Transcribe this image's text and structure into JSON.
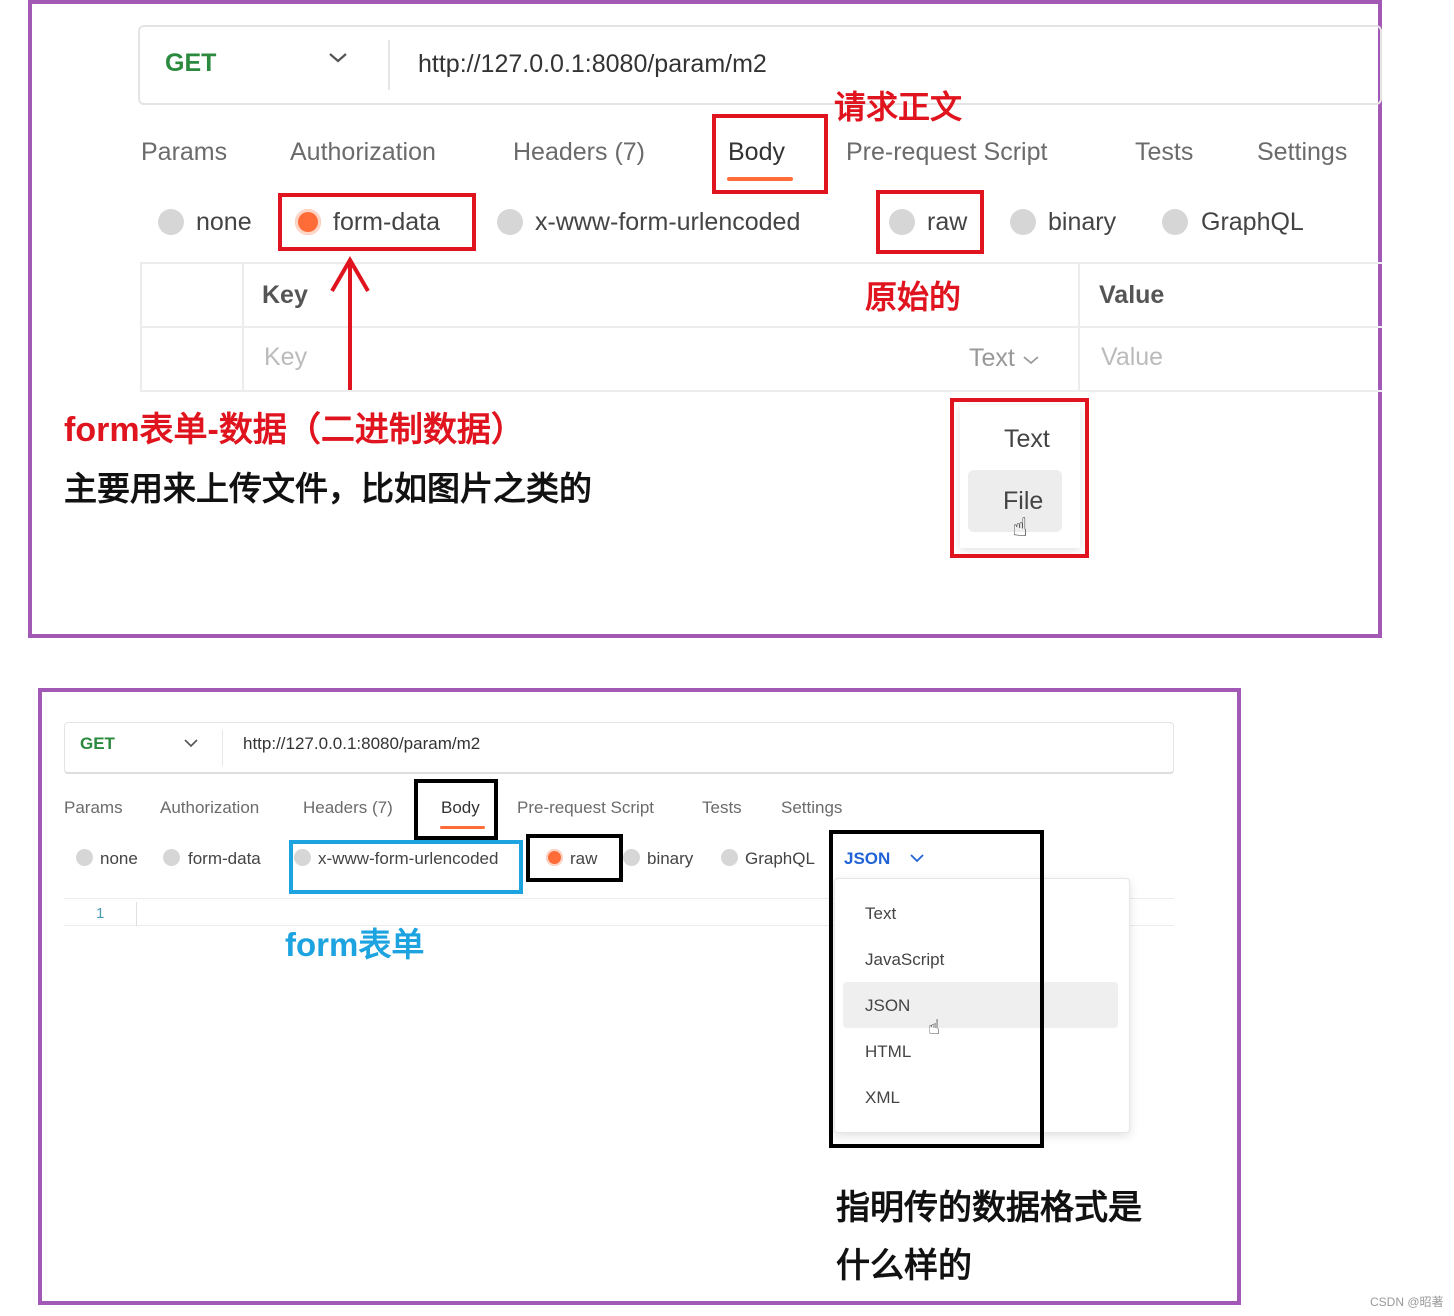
{
  "top": {
    "method": "GET",
    "url": "http://127.0.0.1:8080/param/m2",
    "tabs": [
      "Params",
      "Authorization",
      "Headers (7)",
      "Body",
      "Pre-request Script",
      "Tests",
      "Settings"
    ],
    "body_options": [
      "none",
      "form-data",
      "x-www-form-urlencoded",
      "raw",
      "binary",
      "GraphQL"
    ],
    "table": {
      "key_header": "Key",
      "value_header": "Value",
      "key_placeholder": "Key",
      "type_label": "Text",
      "value_placeholder": "Value"
    },
    "type_dropdown": [
      "Text",
      "File"
    ],
    "annotations": {
      "body_note": "请求正文",
      "raw_note": "原始的",
      "form_data_note": "form表单-数据（二进制数据）",
      "form_data_desc": "主要用来上传文件，比如图片之类的"
    }
  },
  "bottom": {
    "method": "GET",
    "url": "http://127.0.0.1:8080/param/m2",
    "tabs": [
      "Params",
      "Authorization",
      "Headers (7)",
      "Body",
      "Pre-request Script",
      "Tests",
      "Settings"
    ],
    "body_options": [
      "none",
      "form-data",
      "x-www-form-urlencoded",
      "raw",
      "binary",
      "GraphQL"
    ],
    "format_selected": "JSON",
    "format_options": [
      "Text",
      "JavaScript",
      "JSON",
      "HTML",
      "XML"
    ],
    "line_number": "1",
    "annotations": {
      "urlencoded_note": "form表单",
      "format_note_line1": "指明传的数据格式是",
      "format_note_line2": "什么样的"
    }
  },
  "watermark": "CSDN @昭著",
  "colors": {
    "frame": "#a259b5",
    "highlight_red": "#e0141e",
    "highlight_blue": "#1ca3e0",
    "accent_orange": "#ff6c37",
    "method_green": "#2b8a3e"
  }
}
